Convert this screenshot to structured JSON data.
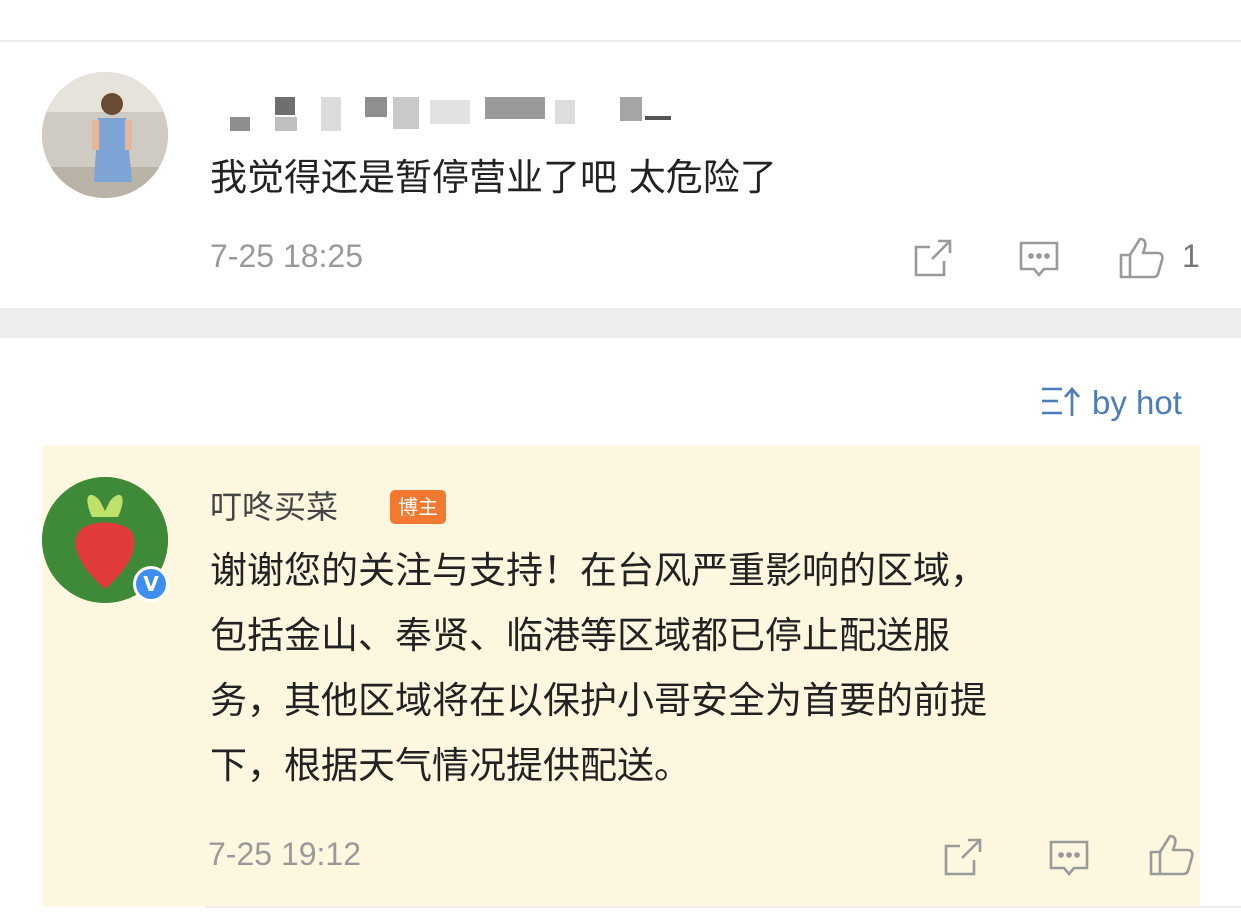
{
  "comment1": {
    "text": "我觉得还是暂停营业了吧 太危险了",
    "time": "7-25 18:25",
    "like_count": "1",
    "icons": {
      "share": "share-icon",
      "reply": "comment-icon",
      "like": "thumbs-up-icon"
    }
  },
  "sort": {
    "label": "by hot",
    "icon": "sort-icon"
  },
  "reply": {
    "author": "叮咚买菜",
    "badge": "博主",
    "verified_mark": "V",
    "lines": [
      "谢谢您的关注与支持！在台风严重影响的区域，",
      "包括金山、奉贤、临港等区域都已停止配送服",
      "务，其他区域将在以保护小哥安全为首要的前提",
      "下，根据天气情况提供配送。"
    ],
    "time": "7-25 19:12",
    "colors": {
      "highlight_bg": "#fdf7e0",
      "badge": "#f27930",
      "verified": "#3d8ef0",
      "link": "#4a7dba"
    }
  }
}
